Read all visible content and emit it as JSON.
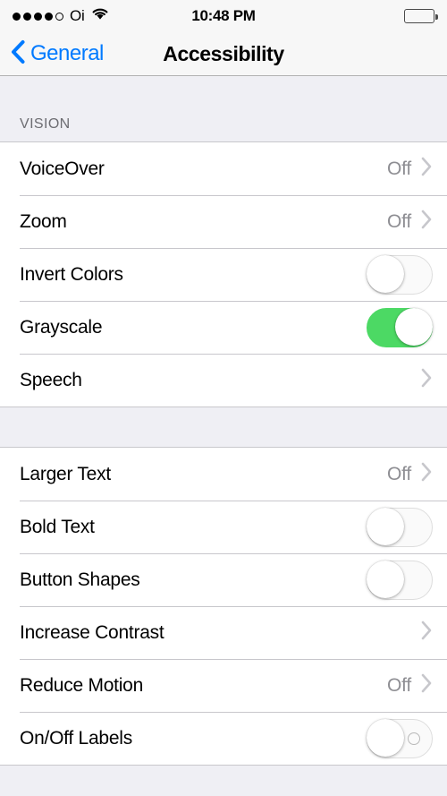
{
  "status_bar": {
    "signal_dots_total": 5,
    "signal_dots_filled": 4,
    "carrier": "Oi",
    "wifi_icon": "wifi-icon",
    "time": "10:48 PM",
    "battery_icon": "battery-full-icon"
  },
  "nav_bar": {
    "back_icon": "chevron-left-icon",
    "back_label": "General",
    "title": "Accessibility"
  },
  "colors": {
    "tint_blue": "#007AFF",
    "switch_on_green": "#4CD964",
    "value_gray": "#8E8E93",
    "group_bg": "#EFEFF4",
    "separator": "#C8C7CC"
  },
  "sections": [
    {
      "header": "VISION",
      "rows": [
        {
          "label": "VoiceOver",
          "value": "Off",
          "accessory": "chevron",
          "chevron_icon": "chevron-right-icon"
        },
        {
          "label": "Zoom",
          "value": "Off",
          "accessory": "chevron",
          "chevron_icon": "chevron-right-icon"
        },
        {
          "label": "Invert Colors",
          "value": "",
          "accessory": "switch",
          "switch_state": "off",
          "switch_label": false
        },
        {
          "label": "Grayscale",
          "value": "",
          "accessory": "switch",
          "switch_state": "on",
          "switch_label": false
        },
        {
          "label": "Speech",
          "value": "",
          "accessory": "chevron",
          "chevron_icon": "chevron-right-icon"
        }
      ]
    },
    {
      "header": "",
      "rows": [
        {
          "label": "Larger Text",
          "value": "Off",
          "accessory": "chevron",
          "chevron_icon": "chevron-right-icon"
        },
        {
          "label": "Bold Text",
          "value": "",
          "accessory": "switch",
          "switch_state": "off",
          "switch_label": false
        },
        {
          "label": "Button Shapes",
          "value": "",
          "accessory": "switch",
          "switch_state": "off",
          "switch_label": false
        },
        {
          "label": "Increase Contrast",
          "value": "",
          "accessory": "chevron",
          "chevron_icon": "chevron-right-icon"
        },
        {
          "label": "Reduce Motion",
          "value": "Off",
          "accessory": "chevron",
          "chevron_icon": "chevron-right-icon"
        },
        {
          "label": "On/Off Labels",
          "value": "",
          "accessory": "switch",
          "switch_state": "off",
          "switch_label": true
        }
      ]
    }
  ]
}
